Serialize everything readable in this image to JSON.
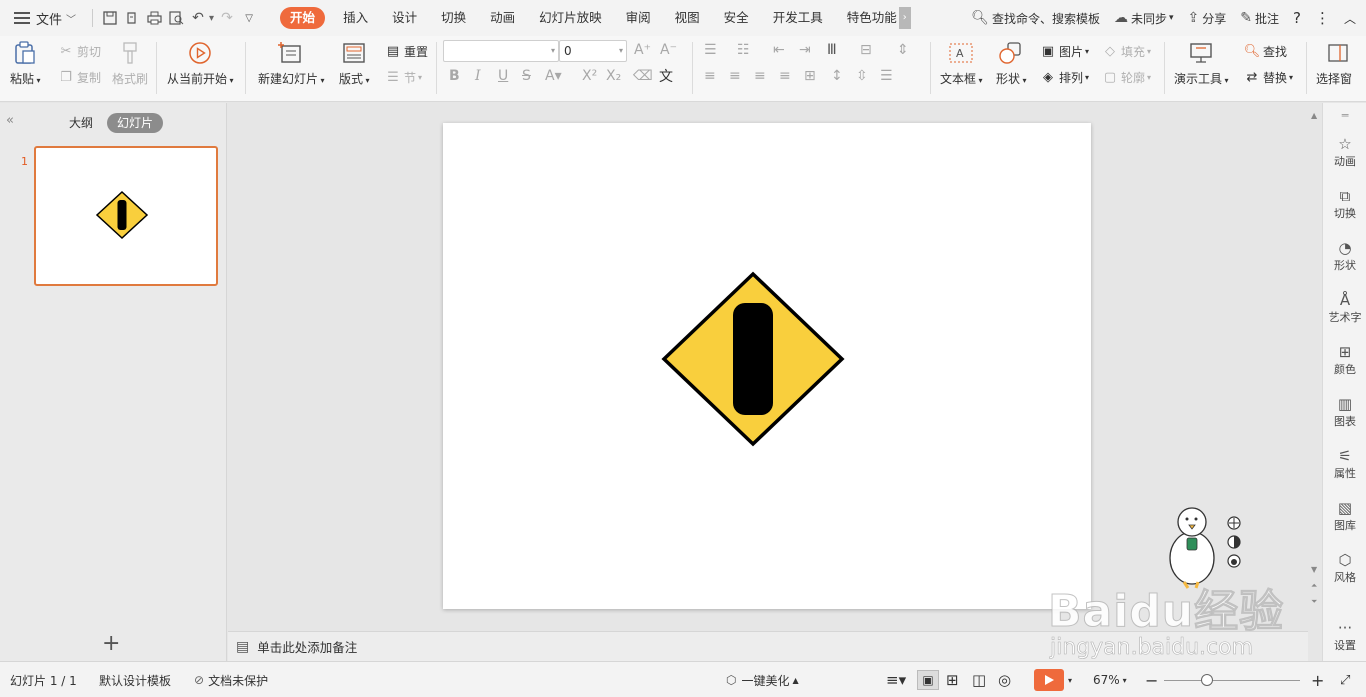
{
  "menubar": {
    "file_label": "文件",
    "tabs": [
      {
        "label": "开始",
        "active": true
      },
      {
        "label": "插入"
      },
      {
        "label": "设计"
      },
      {
        "label": "切换"
      },
      {
        "label": "动画"
      },
      {
        "label": "幻灯片放映"
      },
      {
        "label": "审阅"
      },
      {
        "label": "视图"
      },
      {
        "label": "安全"
      },
      {
        "label": "开发工具"
      },
      {
        "label": "特色功能"
      }
    ],
    "search_placeholder": "查找命令、搜索模板",
    "sync_label": "未同步",
    "share_label": "分享",
    "comment_label": "批注"
  },
  "ribbon": {
    "paste": "粘贴",
    "cut": "剪切",
    "copy": "复制",
    "format_painter": "格式刷",
    "from_current": "从当前开始",
    "new_slide": "新建幻灯片",
    "layout": "版式",
    "reset": "重置",
    "section": "节",
    "font_size": "0",
    "text_box": "文本框",
    "shape": "形状",
    "picture": "图片",
    "fill": "填充",
    "arrange": "排列",
    "outline": "轮廓",
    "presentation_tools": "演示工具",
    "find": "查找",
    "replace": "替换",
    "select_pane": "选择窗"
  },
  "left_panel": {
    "tab_outline": "大纲",
    "tab_slides": "幻灯片",
    "slide_number": "1"
  },
  "notes": {
    "placeholder": "单击此处添加备注"
  },
  "right_sidebar": [
    {
      "label": "动画",
      "icon": "star-animation-icon"
    },
    {
      "label": "切换",
      "icon": "transition-icon"
    },
    {
      "label": "形状",
      "icon": "shape-icon"
    },
    {
      "label": "艺术字",
      "icon": "wordart-icon"
    },
    {
      "label": "颜色",
      "icon": "color-grid-icon"
    },
    {
      "label": "图表",
      "icon": "chart-icon"
    },
    {
      "label": "属性",
      "icon": "properties-icon"
    },
    {
      "label": "图库",
      "icon": "gallery-icon"
    },
    {
      "label": "风格",
      "icon": "style-icon"
    },
    {
      "label": "设置",
      "icon": "more-icon"
    }
  ],
  "statusbar": {
    "slide_info": "幻灯片 1 / 1",
    "template": "默认设计模板",
    "protection": "文档未保护",
    "beautify": "一键美化",
    "zoom": "67%"
  },
  "slide": {
    "sign_fill": "#f9cf3d",
    "sign_border": "#000000",
    "bar_fill": "#000000"
  },
  "watermark": {
    "brand": "Baidu经验",
    "url": "jingyan.baidu.com"
  }
}
